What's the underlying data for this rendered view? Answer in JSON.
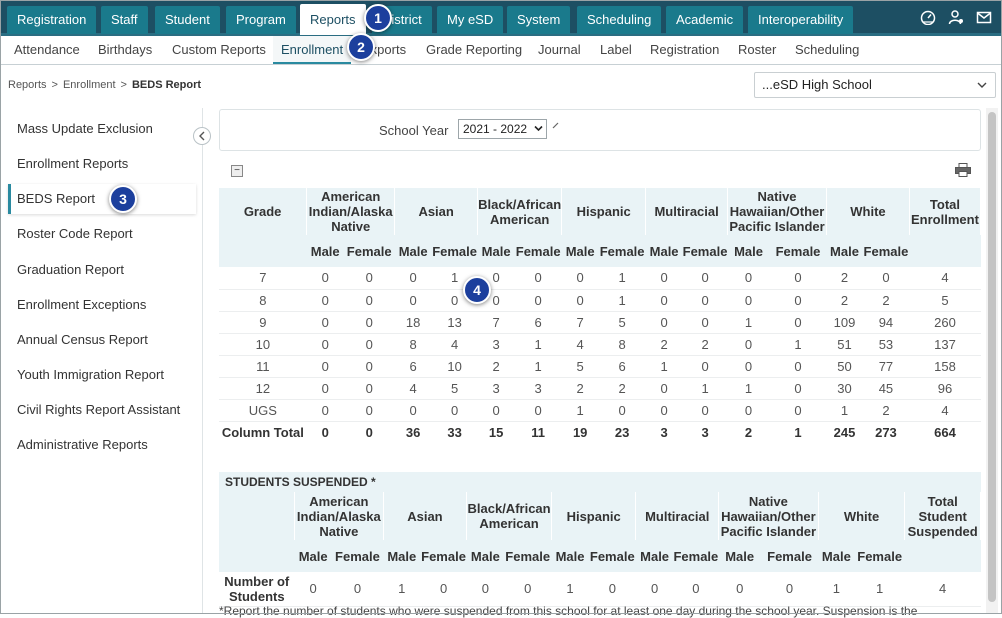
{
  "topnav": {
    "items": [
      "Registration",
      "Staff",
      "Student",
      "Program",
      "Reports",
      "District",
      "My eSD",
      "System",
      "Scheduling",
      "Academic",
      "Interoperability"
    ],
    "active_index": 4,
    "icons": [
      "dashboard-icon",
      "user-settings-icon",
      "mail-icon"
    ]
  },
  "subnav": {
    "items": [
      "Attendance",
      "Birthdays",
      "Custom Reports",
      "Enrollment",
      "Exports",
      "Grade Reporting",
      "Journal",
      "Label",
      "Registration",
      "Roster",
      "Scheduling"
    ],
    "active_index": 3
  },
  "breadcrumb": {
    "items": [
      "Reports",
      "Enrollment"
    ],
    "current": "BEDS Report"
  },
  "school_select": {
    "value": "...eSD High School"
  },
  "sidebar": {
    "items": [
      "Mass Update Exclusion",
      "Enrollment Reports",
      "BEDS Report",
      "Roster Code Report",
      "Graduation Report",
      "Enrollment Exceptions",
      "Annual Census Report",
      "Youth Immigration Report",
      "Civil Rights Report Assistant",
      "Administrative Reports"
    ],
    "active_index": 2
  },
  "filter": {
    "label": "School Year",
    "value": "2021 - 2022"
  },
  "enrollment": {
    "grade_header": "Grade",
    "groups": [
      "American Indian/Alaska Native",
      "Asian",
      "Black/African American",
      "Hispanic",
      "Multiracial",
      "Native Hawaiian/Other Pacific Islander",
      "White"
    ],
    "total_header": "Total Enrollment",
    "sub": [
      "Male",
      "Female"
    ],
    "rows": [
      {
        "label": "7",
        "values": [
          "0",
          "0",
          "0",
          "1",
          "0",
          "0",
          "0",
          "1",
          "0",
          "0",
          "0",
          "0",
          "2",
          "0"
        ],
        "total": "4"
      },
      {
        "label": "8",
        "values": [
          "0",
          "0",
          "0",
          "0",
          "0",
          "0",
          "0",
          "1",
          "0",
          "0",
          "0",
          "0",
          "2",
          "2"
        ],
        "total": "5"
      },
      {
        "label": "9",
        "values": [
          "0",
          "0",
          "18",
          "13",
          "7",
          "6",
          "7",
          "5",
          "0",
          "0",
          "1",
          "0",
          "109",
          "94"
        ],
        "total": "260"
      },
      {
        "label": "10",
        "values": [
          "0",
          "0",
          "8",
          "4",
          "3",
          "1",
          "4",
          "8",
          "2",
          "2",
          "0",
          "1",
          "51",
          "53"
        ],
        "total": "137"
      },
      {
        "label": "11",
        "values": [
          "0",
          "0",
          "6",
          "10",
          "2",
          "1",
          "5",
          "6",
          "1",
          "0",
          "0",
          "0",
          "50",
          "77"
        ],
        "total": "158"
      },
      {
        "label": "12",
        "values": [
          "0",
          "0",
          "4",
          "5",
          "3",
          "3",
          "2",
          "2",
          "0",
          "1",
          "1",
          "0",
          "30",
          "45"
        ],
        "total": "96"
      },
      {
        "label": "UGS",
        "values": [
          "0",
          "0",
          "0",
          "0",
          "0",
          "0",
          "1",
          "0",
          "0",
          "0",
          "0",
          "0",
          "1",
          "2"
        ],
        "total": "4"
      }
    ],
    "totals": {
      "label": "Column Total",
      "values": [
        "0",
        "0",
        "36",
        "33",
        "15",
        "11",
        "19",
        "23",
        "3",
        "3",
        "2",
        "1",
        "245",
        "273"
      ],
      "total": "664"
    }
  },
  "suspended": {
    "title": "STUDENTS SUSPENDED *",
    "groups": [
      "American Indian/Alaska Native",
      "Asian",
      "Black/African American",
      "Hispanic",
      "Multiracial",
      "Native Hawaiian/Other Pacific Islander",
      "White"
    ],
    "total_header": "Total Student Suspended",
    "sub": [
      "Male",
      "Female"
    ],
    "row": {
      "label": "Number of Students",
      "values": [
        "0",
        "0",
        "1",
        "0",
        "0",
        "0",
        "1",
        "0",
        "0",
        "0",
        "0",
        "0",
        "1",
        "1"
      ],
      "total": "4"
    }
  },
  "footnote": "*Report the number of students who were suspended from this school for at least one day during the school year. Suspension is the",
  "callouts": [
    "1",
    "2",
    "3",
    "4"
  ]
}
